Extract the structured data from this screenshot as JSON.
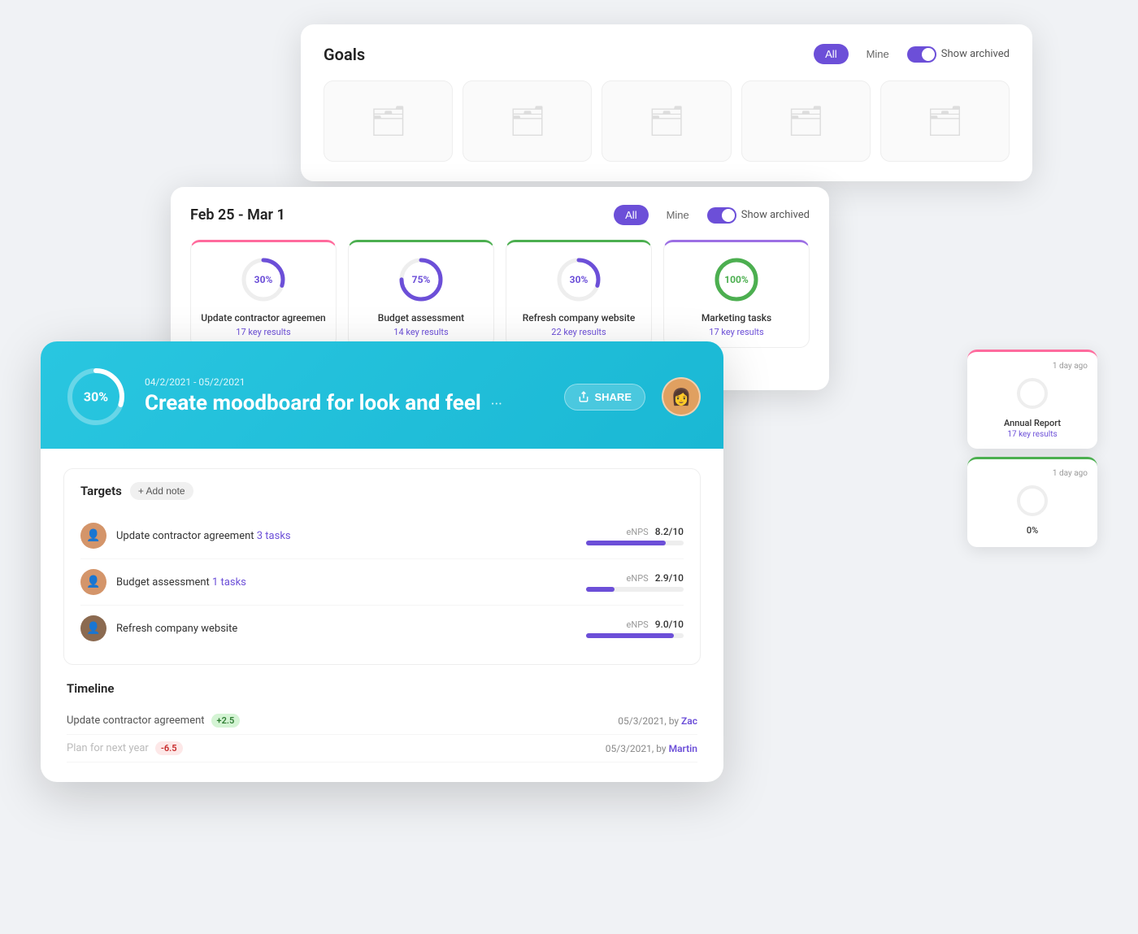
{
  "goals_panel": {
    "title": "Goals",
    "filter_all": "All",
    "filter_mine": "Mine",
    "toggle_label": "Show archived",
    "folders": [
      {
        "id": 1
      },
      {
        "id": 2
      },
      {
        "id": 3
      },
      {
        "id": 4
      },
      {
        "id": 5
      }
    ]
  },
  "weekly_panel": {
    "date_range": "Feb 25 - Mar 1",
    "filter_all": "All",
    "filter_mine": "Mine",
    "toggle_label": "Show archived",
    "cards": [
      {
        "id": 1,
        "color": "pink",
        "percent": 30,
        "name": "Update contractor agreemen",
        "sub": "17 key results",
        "label_color": "purple"
      },
      {
        "id": 2,
        "color": "green",
        "percent": 75,
        "name": "Budget assessment",
        "sub": "14 key results",
        "label_color": "purple"
      },
      {
        "id": 3,
        "color": "green",
        "percent": 30,
        "name": "Refresh company website",
        "sub": "22 key results",
        "label_color": "purple"
      },
      {
        "id": 4,
        "color": "purple",
        "percent": 100,
        "name": "Marketing tasks",
        "sub": "17 key results",
        "label_color": "green"
      }
    ]
  },
  "side_cards": [
    {
      "color": "pink",
      "time": "1 day ago",
      "percent": 0,
      "name": "Annual Report",
      "sub": "17 key results"
    },
    {
      "color": "green",
      "time": "1 day ago",
      "percent": 0,
      "name": "",
      "sub": ""
    }
  ],
  "detail_panel": {
    "date_range": "04/2/2021 - 05/2/2021",
    "percent": 30,
    "title": "Create moodboard for look and feel",
    "share_label": "SHARE",
    "targets_title": "Targets",
    "add_note_label": "+ Add note",
    "targets": [
      {
        "name": "Update contractor agreement",
        "link_text": "3 tasks",
        "metric_label": "eNPS",
        "metric_value": "8.2/10",
        "progress": 82,
        "avatar_type": "medium"
      },
      {
        "name": "Budget assessment",
        "link_text": "1 tasks",
        "metric_label": "eNPS",
        "metric_value": "2.9/10",
        "progress": 29,
        "avatar_type": "medium"
      },
      {
        "name": "Refresh company website",
        "link_text": "",
        "metric_label": "eNPS",
        "metric_value": "9.0/10",
        "progress": 90,
        "avatar_type": "dark"
      }
    ],
    "timeline_title": "Timeline",
    "timeline_items": [
      {
        "name": "Update contractor agreement",
        "badge": "+2.5",
        "badge_type": "green",
        "date": "05/3/2021, by",
        "author": "Zac"
      },
      {
        "name": "Plan for next year",
        "badge": "-6.5",
        "badge_type": "red",
        "date": "05/3/2021, by",
        "author": "Martin"
      }
    ]
  }
}
